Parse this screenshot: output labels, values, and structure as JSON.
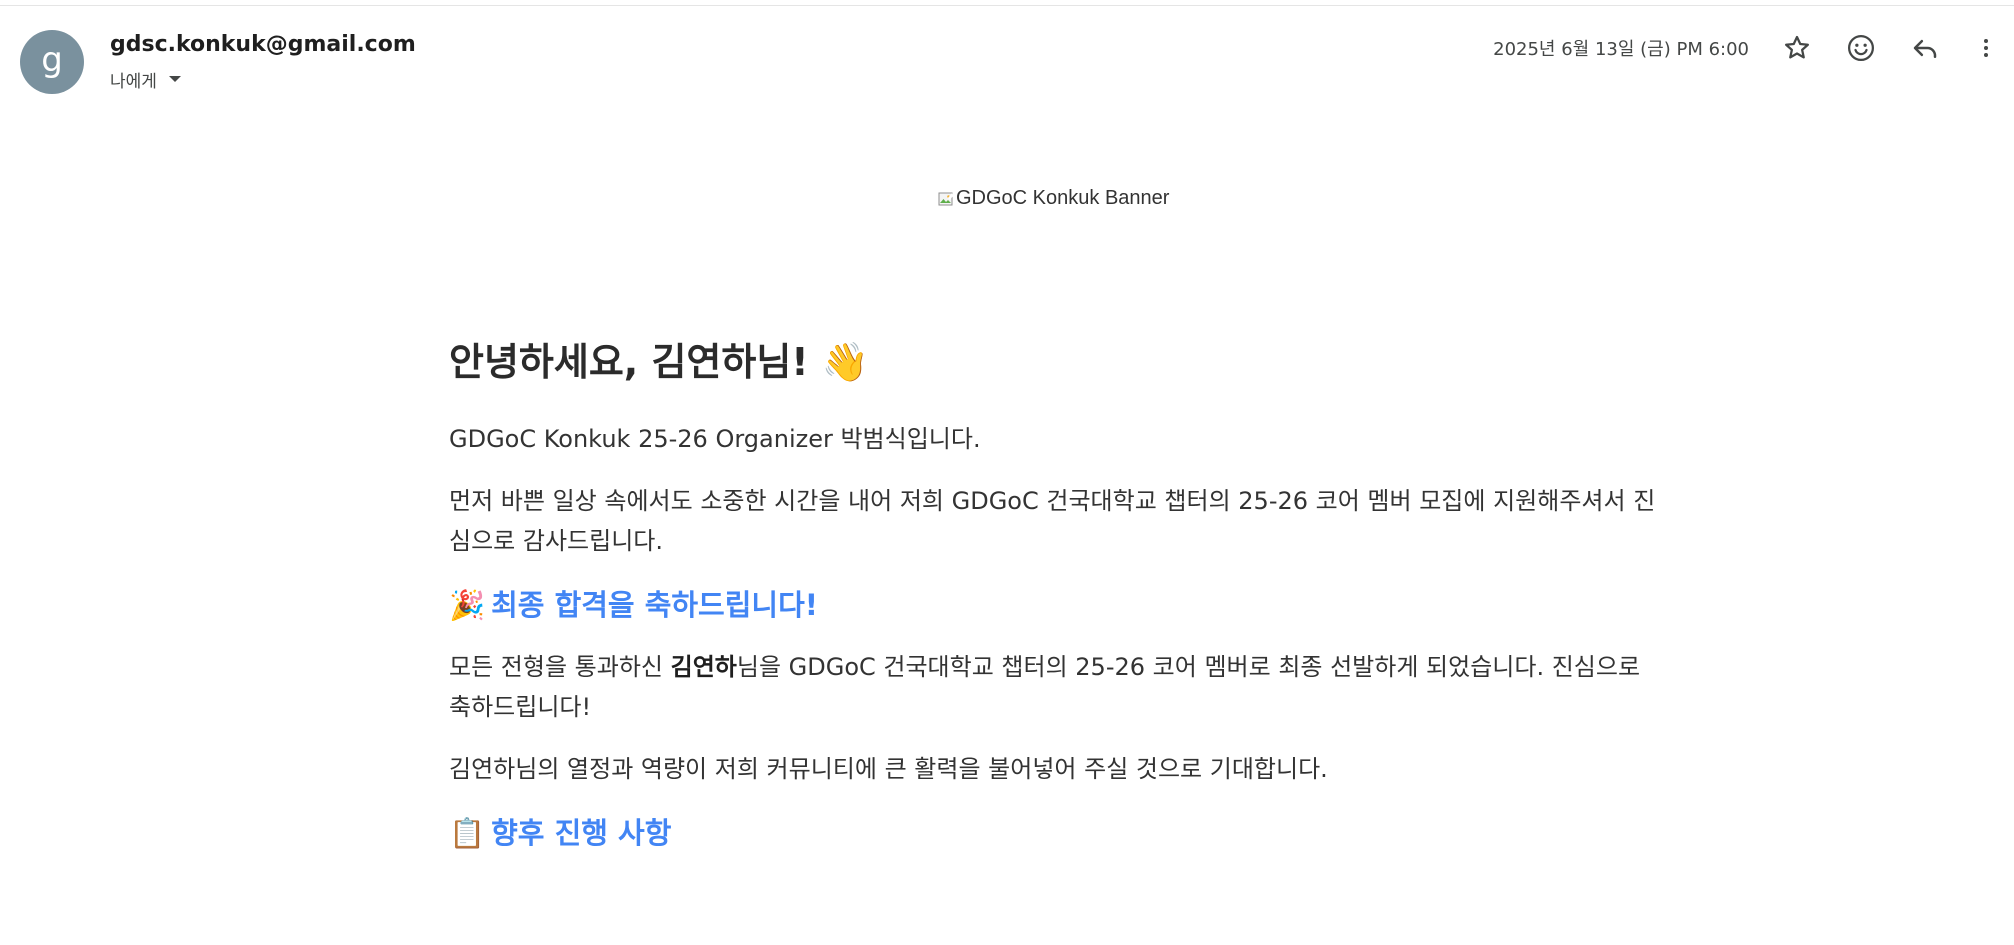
{
  "header": {
    "avatar_letter": "g",
    "sender_email": "gdsc.konkuk@gmail.com",
    "recipient_label": "나에게",
    "date": "2025년 6월 13일 (금) PM 6:00",
    "icons": [
      "star-icon",
      "emoji-icon",
      "reply-icon",
      "more-vert-icon"
    ]
  },
  "email": {
    "banner_alt": "GDGoC Konkuk Banner",
    "greeting": "안녕하세요, 김연하님!",
    "greeting_emoji": "👋",
    "intro": "GDGoC Konkuk 25-26 Organizer 박범식입니다.",
    "thanks": "먼저 바쁜 일상 속에서도 소중한 시간을 내어 저희 GDGoC 건국대학교 챕터의 25-26 코어 멤버 모집에 지원해주셔서 진심으로 감사드립니다.",
    "section1_emoji": "🎉",
    "section1_title": "최종 합격을 축하드립니다!",
    "congrats_prefix": "모든 전형을 통과하신 ",
    "congrats_name": "김연하",
    "congrats_suffix": "님을 GDGoC 건국대학교 챕터의 25-26 코어 멤버로 최종 선발하게 되었습니다. 진심으로 축하드립니다!",
    "expectation": "김연하님의 열정과 역량이 저희 커뮤니티에 큰 활력을 불어넣어 주실 것으로 기대합니다.",
    "section2_emoji": "📋",
    "section2_title": "향후 진행 사항"
  },
  "colors": {
    "accent": "#4285f4",
    "avatar_bg": "#7a919e",
    "text": "#333333"
  }
}
